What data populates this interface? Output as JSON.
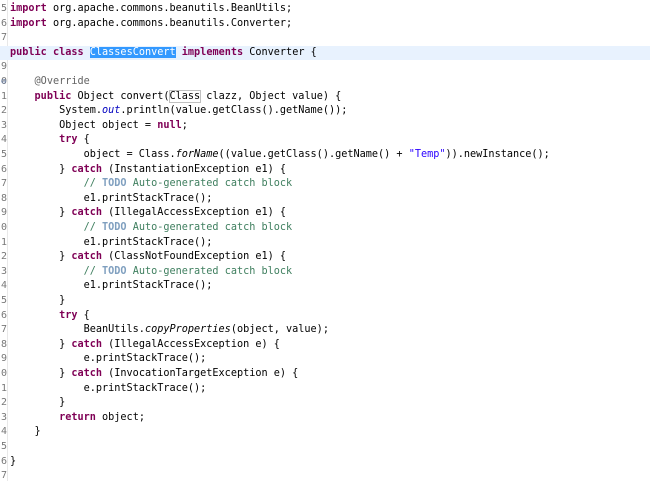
{
  "editor": {
    "line_numbers": [
      "5",
      "6",
      "7",
      "8",
      "9",
      "0",
      "1",
      "2",
      "3",
      "4",
      "5",
      "6",
      "7",
      "8",
      "9",
      "0",
      "1",
      "2",
      "3",
      "4",
      "5",
      "6",
      "7",
      "8",
      "9",
      "0",
      "1",
      "2",
      "3",
      "4",
      "5",
      "6",
      "7"
    ],
    "current_line": 3,
    "selected_token": "ClassesConvert",
    "lines": [
      [
        {
          "t": "import",
          "s": "kw"
        },
        {
          "t": " org.apache.commons.beanutils.BeanUtils;"
        }
      ],
      [
        {
          "t": "import",
          "s": "kw"
        },
        {
          "t": " org.apache.commons.beanutils.Converter;"
        }
      ],
      [],
      [
        {
          "t": "public",
          "s": "kw"
        },
        {
          "t": " "
        },
        {
          "t": "class",
          "s": "kw"
        },
        {
          "t": " "
        },
        {
          "t": "ClassesConvert",
          "s": "sel"
        },
        {
          "t": " "
        },
        {
          "t": "implements",
          "s": "kw"
        },
        {
          "t": " Converter {"
        }
      ],
      [],
      [
        {
          "t": "    "
        },
        {
          "t": "@Override",
          "s": "an"
        }
      ],
      [
        {
          "t": "    "
        },
        {
          "t": "public",
          "s": "kw"
        },
        {
          "t": " Object convert("
        },
        {
          "t": "Class",
          "s": "brace"
        },
        {
          "t": " clazz, Object value) {"
        }
      ],
      [
        {
          "t": "        System."
        },
        {
          "t": "out",
          "s": "fld"
        },
        {
          "t": ".println(value.getClass().getName());"
        }
      ],
      [
        {
          "t": "        Object object = "
        },
        {
          "t": "null",
          "s": "kw"
        },
        {
          "t": ";"
        }
      ],
      [
        {
          "t": "        "
        },
        {
          "t": "try",
          "s": "kw"
        },
        {
          "t": " {"
        }
      ],
      [
        {
          "t": "            object = Class."
        },
        {
          "t": "forName",
          "s": "it"
        },
        {
          "t": "((value.getClass().getName() + "
        },
        {
          "t": "\"Temp\"",
          "s": "st"
        },
        {
          "t": ")).newInstance();"
        }
      ],
      [
        {
          "t": "        } "
        },
        {
          "t": "catch",
          "s": "kw"
        },
        {
          "t": " (InstantiationException e1) {"
        }
      ],
      [
        {
          "t": "            "
        },
        {
          "t": "// ",
          "s": "cm"
        },
        {
          "t": "TODO",
          "s": "todo"
        },
        {
          "t": " Auto-generated catch block",
          "s": "cm"
        }
      ],
      [
        {
          "t": "            e1.printStackTrace();"
        }
      ],
      [
        {
          "t": "        } "
        },
        {
          "t": "catch",
          "s": "kw"
        },
        {
          "t": " (IllegalAccessException e1) {"
        }
      ],
      [
        {
          "t": "            "
        },
        {
          "t": "// ",
          "s": "cm"
        },
        {
          "t": "TODO",
          "s": "todo"
        },
        {
          "t": " Auto-generated catch block",
          "s": "cm"
        }
      ],
      [
        {
          "t": "            e1.printStackTrace();"
        }
      ],
      [
        {
          "t": "        } "
        },
        {
          "t": "catch",
          "s": "kw"
        },
        {
          "t": " (ClassNotFoundException e1) {"
        }
      ],
      [
        {
          "t": "            "
        },
        {
          "t": "// ",
          "s": "cm"
        },
        {
          "t": "TODO",
          "s": "todo"
        },
        {
          "t": " Auto-generated catch block",
          "s": "cm"
        }
      ],
      [
        {
          "t": "            e1.printStackTrace();"
        }
      ],
      [
        {
          "t": "        }"
        }
      ],
      [
        {
          "t": "        "
        },
        {
          "t": "try",
          "s": "kw"
        },
        {
          "t": " {"
        }
      ],
      [
        {
          "t": "            BeanUtils."
        },
        {
          "t": "copyProperties",
          "s": "it"
        },
        {
          "t": "(object, value);"
        }
      ],
      [
        {
          "t": "        } "
        },
        {
          "t": "catch",
          "s": "kw"
        },
        {
          "t": " (IllegalAccessException e) {"
        }
      ],
      [
        {
          "t": "            e.printStackTrace();"
        }
      ],
      [
        {
          "t": "        } "
        },
        {
          "t": "catch",
          "s": "kw"
        },
        {
          "t": " (InvocationTargetException e) {"
        }
      ],
      [
        {
          "t": "            e.printStackTrace();"
        }
      ],
      [
        {
          "t": "        }"
        }
      ],
      [
        {
          "t": "        "
        },
        {
          "t": "return",
          "s": "kw"
        },
        {
          "t": " object;"
        }
      ],
      [
        {
          "t": "    }"
        }
      ],
      [],
      [
        {
          "t": "}"
        }
      ],
      []
    ],
    "markers": {
      "5": "⊖"
    },
    "colors": {
      "keyword": "#7f0055",
      "comment": "#3f7f5f",
      "string": "#2a00ff",
      "annotation": "#646464",
      "field": "#0000c0",
      "selection": "#3399ff",
      "current_line": "#e8f2fe"
    }
  }
}
